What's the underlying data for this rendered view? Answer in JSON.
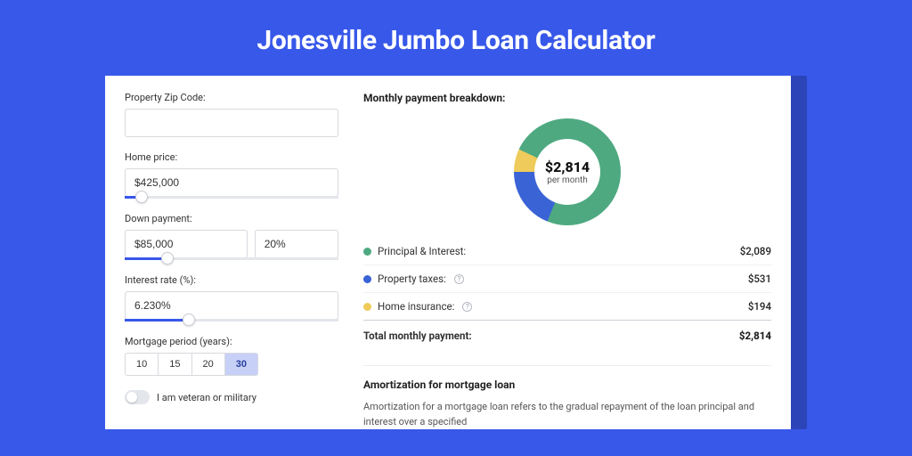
{
  "title": "Jonesville Jumbo Loan Calculator",
  "left": {
    "zip_label": "Property Zip Code:",
    "zip_value": "",
    "price_label": "Home price:",
    "price_value": "$425,000",
    "price_slider_pct": 8,
    "down_label": "Down payment:",
    "down_value": "$85,000",
    "down_pct": "20%",
    "down_slider_pct": 20,
    "rate_label": "Interest rate (%):",
    "rate_value": "6.230%",
    "rate_slider_pct": 30,
    "term_label": "Mortgage period (years):",
    "terms": [
      "10",
      "15",
      "20",
      "30"
    ],
    "term_selected": "30",
    "vet_label": "I am veteran or military"
  },
  "right": {
    "breakdown_title": "Monthly payment breakdown:",
    "donut": {
      "amount": "$2,814",
      "sub": "per month",
      "segments": [
        {
          "color": "#eecb5a",
          "deg": 25
        },
        {
          "color": "#4ea981",
          "deg": 267
        },
        {
          "color": "#3a63d6",
          "deg": 68
        }
      ]
    },
    "items": [
      {
        "label": "Principal & Interest:",
        "value": "$2,089",
        "color": "#4ea981",
        "help": false
      },
      {
        "label": "Property taxes:",
        "value": "$531",
        "color": "#3a63d6",
        "help": true
      },
      {
        "label": "Home insurance:",
        "value": "$194",
        "color": "#eecb5a",
        "help": true
      }
    ],
    "total_label": "Total monthly payment:",
    "total_value": "$2,814",
    "amort_title": "Amortization for mortgage loan",
    "amort_text": "Amortization for a mortgage loan refers to the gradual repayment of the loan principal and interest over a specified"
  }
}
